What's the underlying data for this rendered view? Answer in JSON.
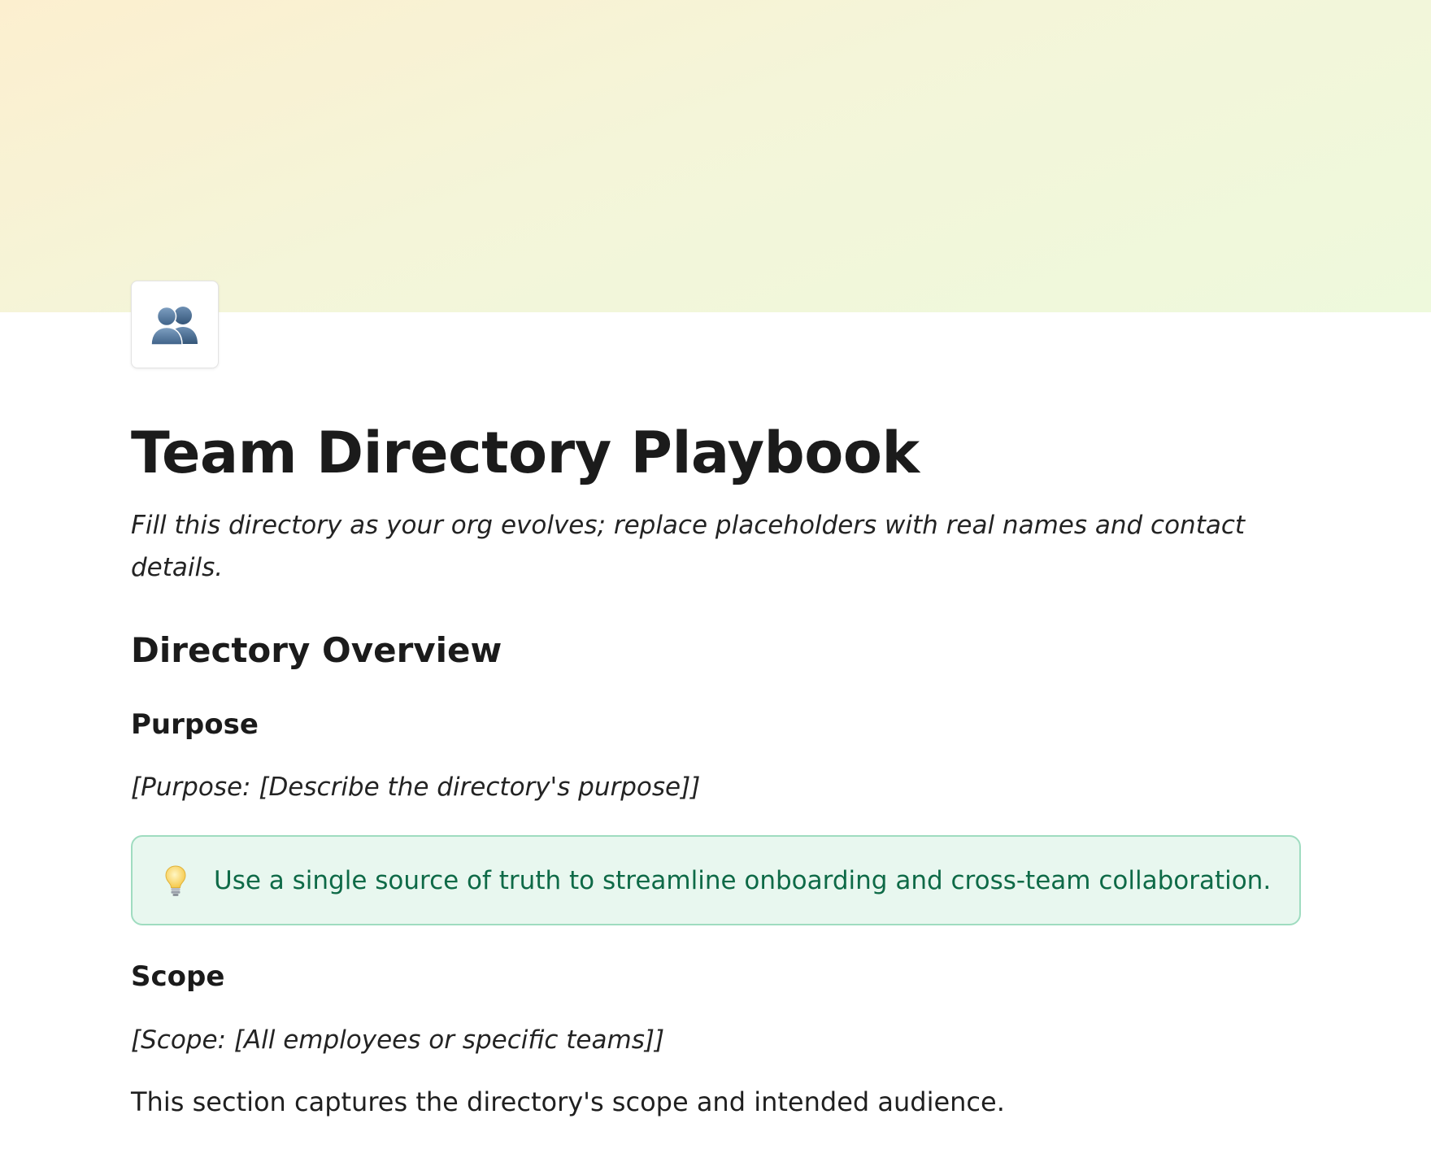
{
  "page": {
    "title": "Team Directory Playbook",
    "subtitle": "Fill this directory as your org evolves; replace placeholders with real names and contact details.",
    "icon": "busts-in-silhouette-icon",
    "cover_colors": [
      "#fcefcf",
      "#eef9dc"
    ]
  },
  "overview": {
    "heading": "Directory Overview",
    "purpose": {
      "heading": "Purpose",
      "placeholder": "[Purpose: [Describe the directory's purpose]]"
    },
    "callout": {
      "icon": "lightbulb-icon",
      "text": "Use a single source of truth to streamline onboarding and cross-team collaboration.",
      "background": "#e8f7ef",
      "border": "#9fdcc0",
      "text_color": "#0e6a47"
    },
    "scope": {
      "heading": "Scope",
      "placeholder": "[Scope: [All employees or specific teams]]",
      "body": "This section captures the directory's scope and intended audience."
    }
  }
}
